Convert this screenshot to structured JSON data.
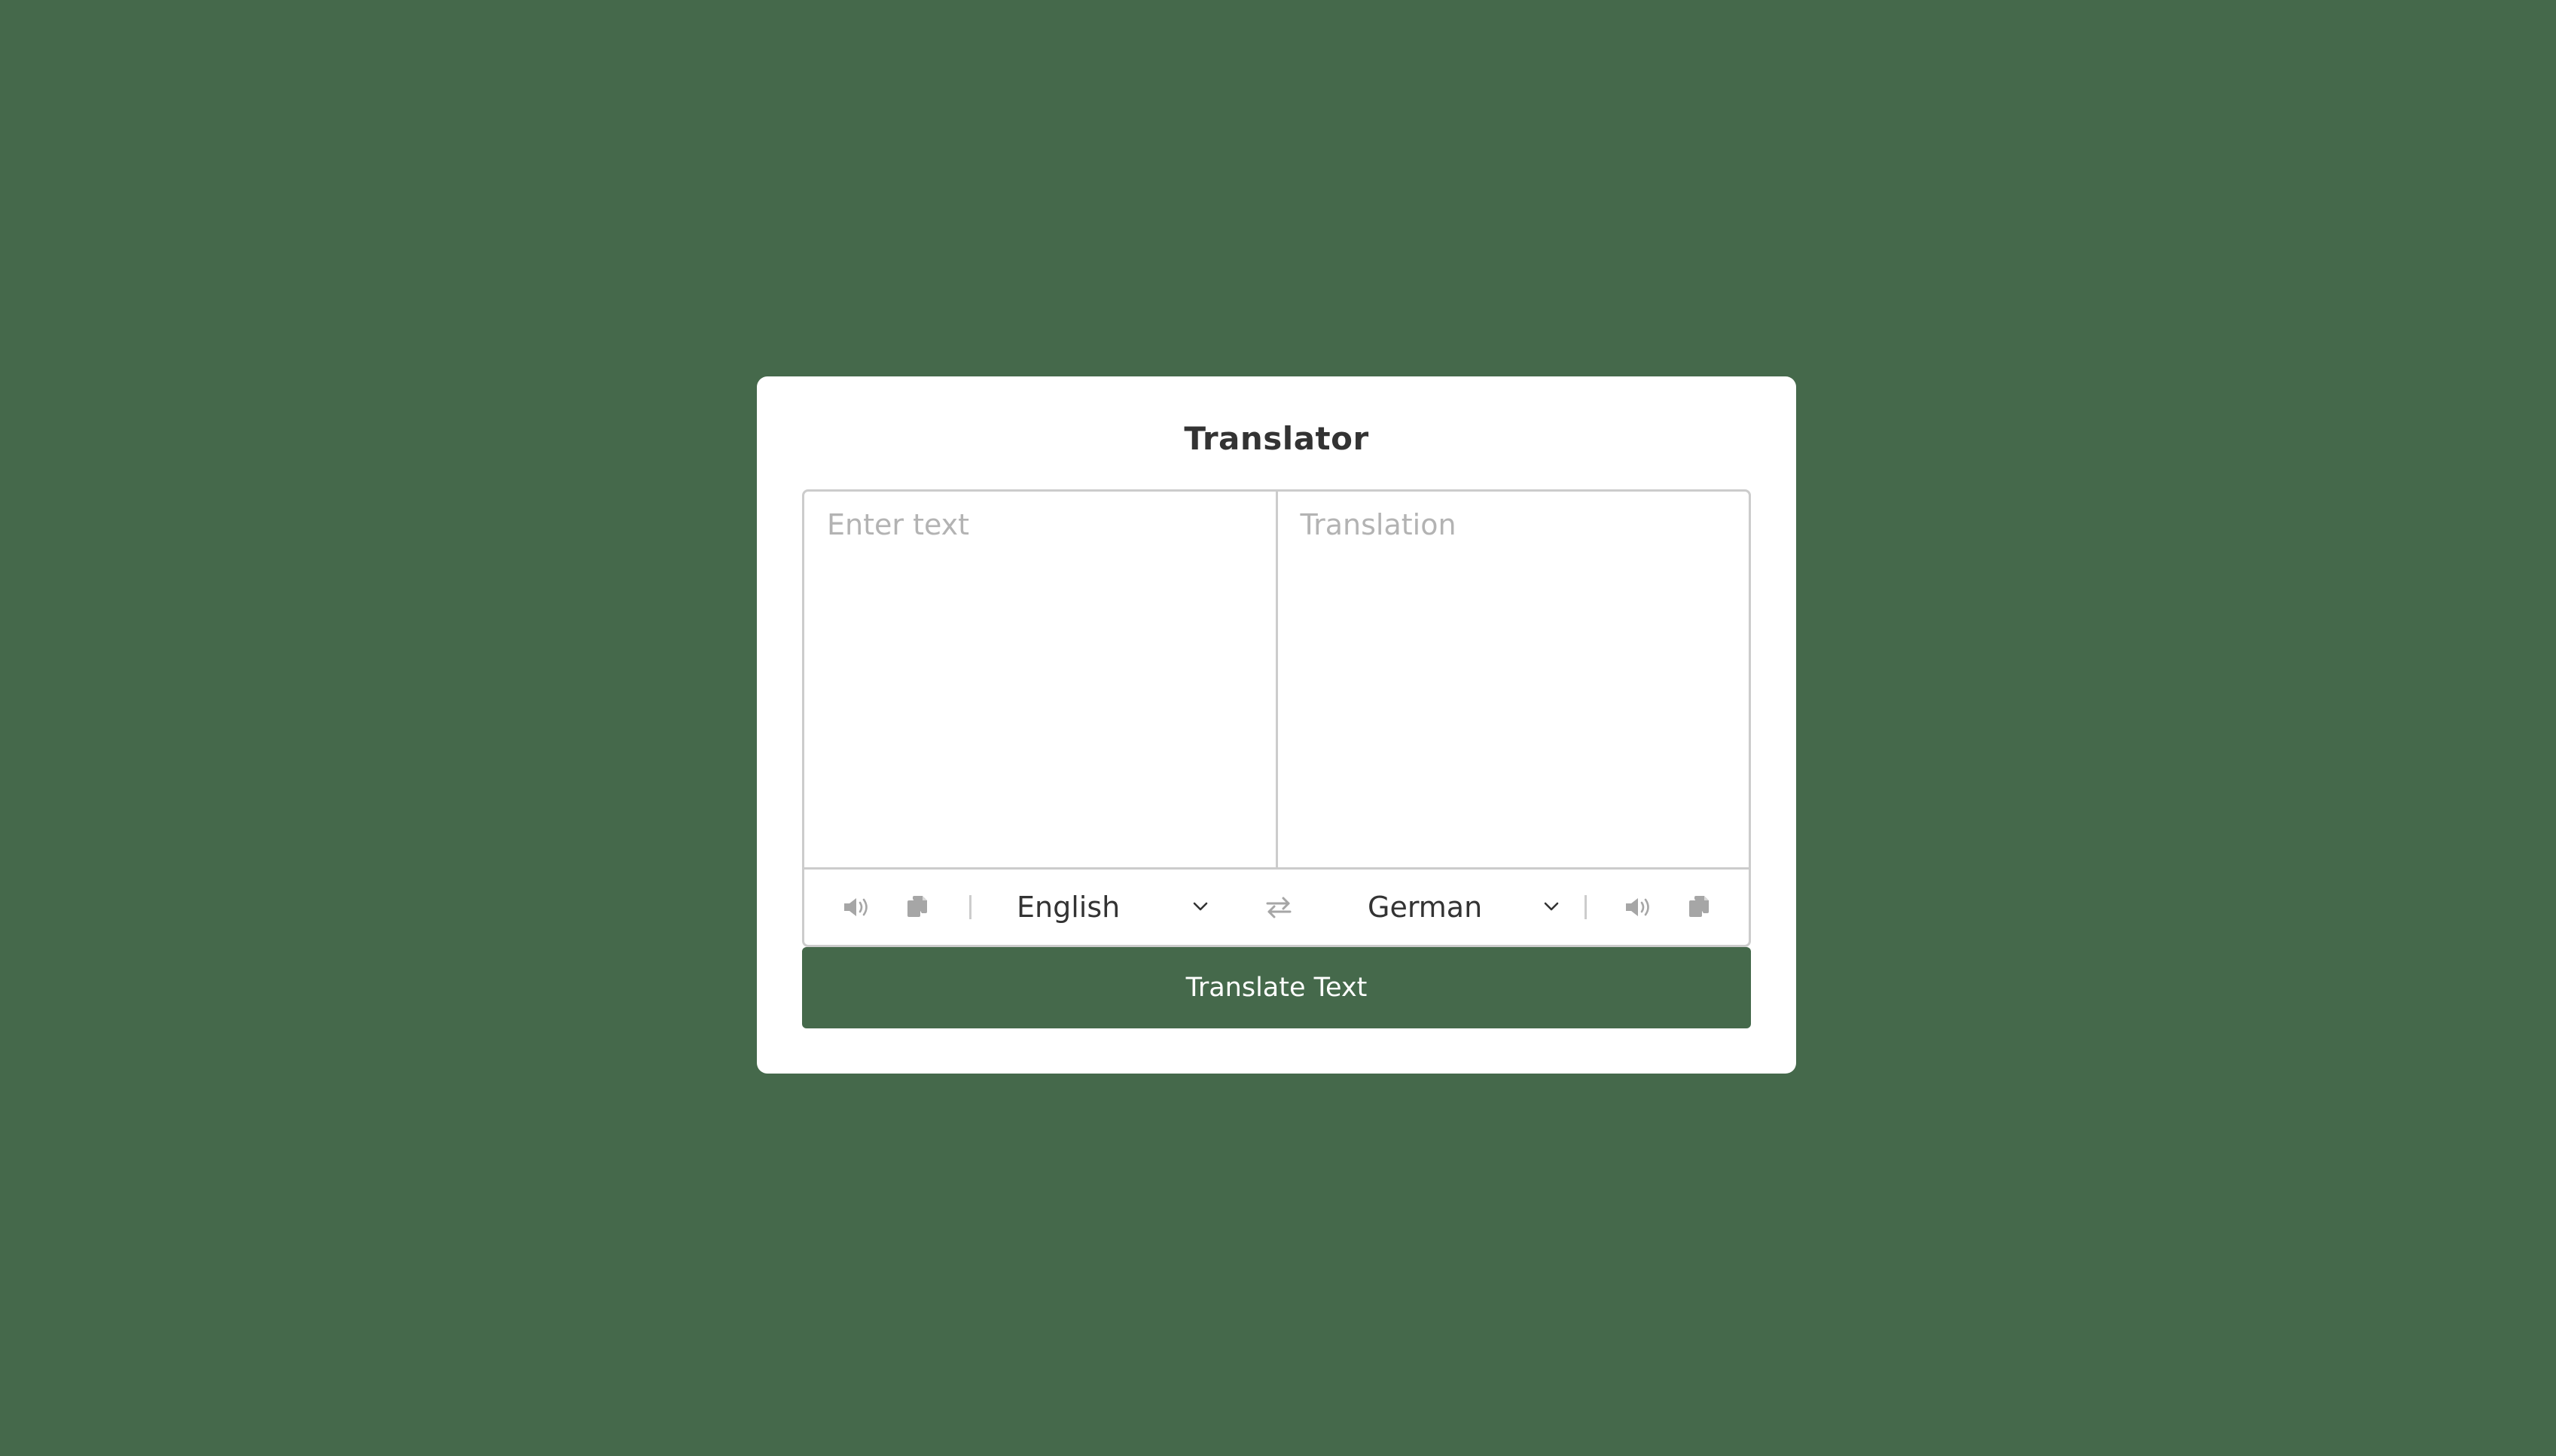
{
  "app": {
    "title": "Translator"
  },
  "source": {
    "placeholder": "Enter text",
    "value": "",
    "language": "English",
    "icons": [
      "volume-icon",
      "copy-icon"
    ]
  },
  "target": {
    "placeholder": "Translation",
    "value": "",
    "language": "German",
    "icons": [
      "volume-icon",
      "copy-icon"
    ]
  },
  "swap": {
    "icon": "exchange-icon"
  },
  "actions": {
    "translate_label": "Translate Text"
  },
  "colors": {
    "background": "#45694b",
    "accent": "#45694b",
    "card": "#ffffff",
    "border": "#cccccc",
    "placeholder": "#b3b3b3",
    "icon": "#a6a6a6"
  }
}
